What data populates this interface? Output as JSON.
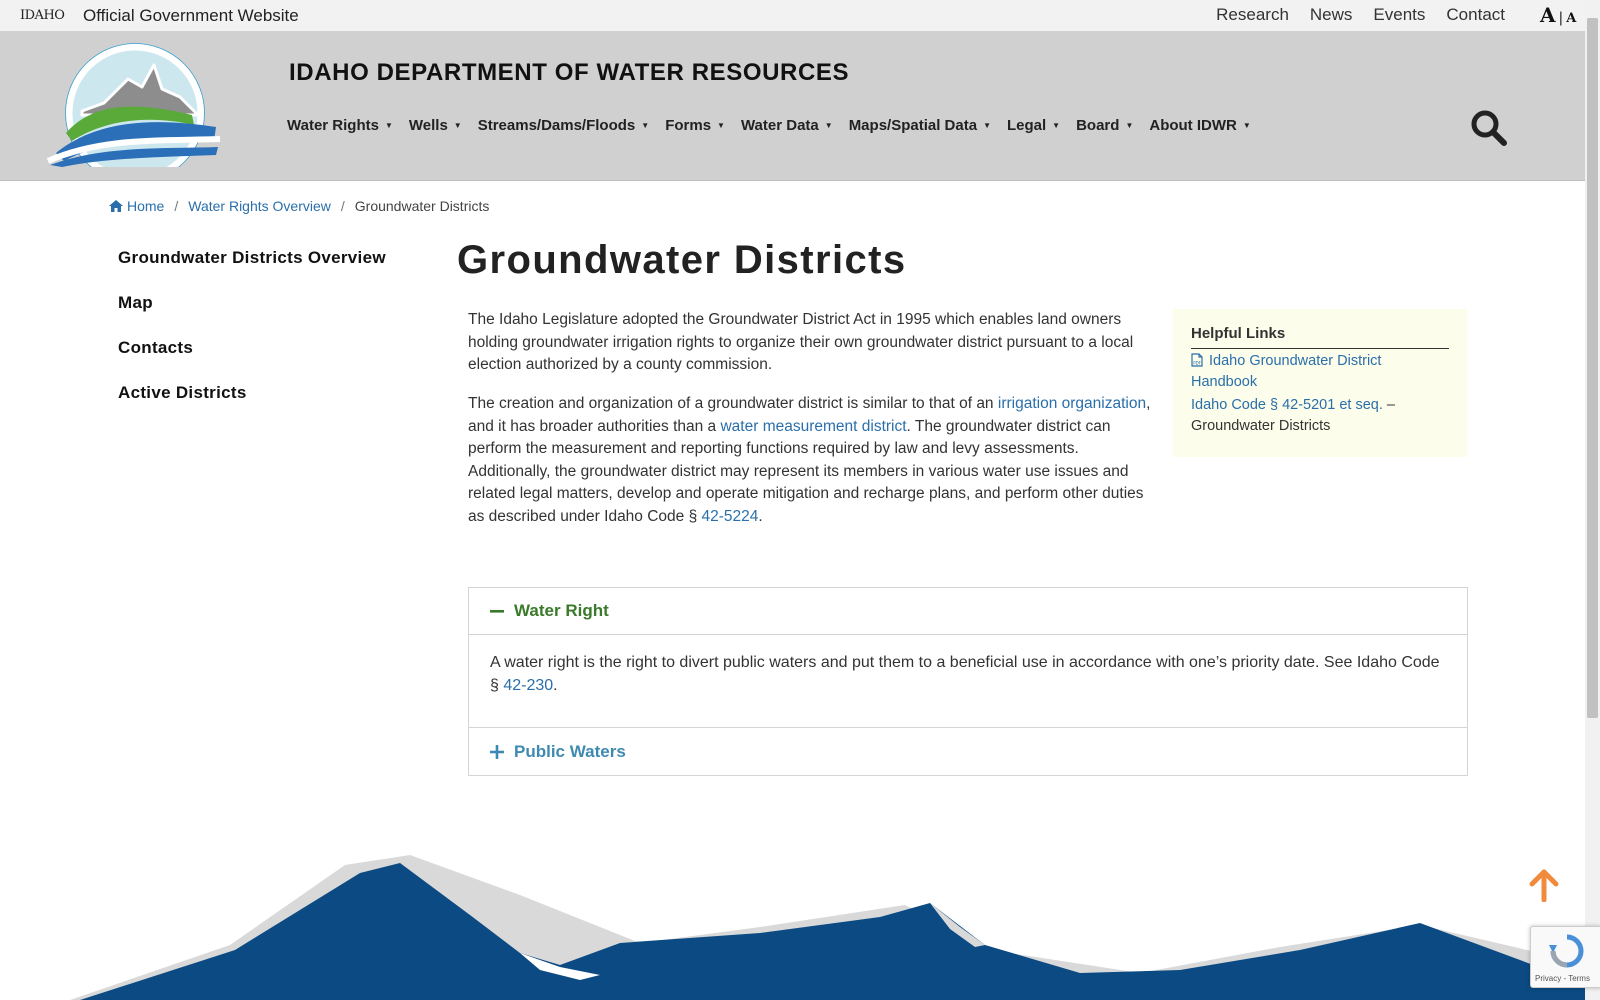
{
  "topbar": {
    "state_logo": "IDAHO",
    "official_label": "Official Government Website",
    "links": [
      "Research",
      "News",
      "Events",
      "Contact"
    ],
    "font_size_large": "A",
    "font_size_separator": "|",
    "font_size_small": "A"
  },
  "header": {
    "site_title": "IDAHO DEPARTMENT OF WATER RESOURCES",
    "nav": [
      "Water Rights",
      "Wells",
      "Streams/Dams/Floods",
      "Forms",
      "Water Data",
      "Maps/Spatial Data",
      "Legal",
      "Board",
      "About IDWR"
    ],
    "caret": "▼"
  },
  "breadcrumb": {
    "home": "Home",
    "separator": "/",
    "parent": "Water Rights Overview",
    "current": "Groundwater Districts"
  },
  "sidenav": [
    "Groundwater Districts Overview",
    "Map",
    "Contacts",
    "Active Districts"
  ],
  "main": {
    "title": "Groundwater Districts",
    "p1": "The Idaho Legislature adopted the Groundwater District Act in 1995 which enables land owners holding groundwater irrigation rights to organize their own groundwater district pursuant to a local election authorized by a county commission.",
    "p2_a": "The creation and organization of a groundwater district is similar to that of an ",
    "p2_link1": "irrigation organization",
    "p2_b": ", and it has broader authorities than a ",
    "p2_link2": "water measurement district",
    "p2_c": ". The groundwater district can perform the measurement and reporting functions required by law and levy assessments. Additionally, the groundwater district may represent its members in various water use issues and related legal matters, develop and operate mitigation and recharge plans, and perform other duties as described under Idaho Code § ",
    "p2_link3": "42-5224",
    "p2_d": "."
  },
  "helpful_links": {
    "heading": "Helpful Links",
    "link1": "Idaho Groundwater District Handbook",
    "link2": "Idaho Code § 42-5201 et seq.",
    "link2_suffix": " – Groundwater Districts"
  },
  "accordion": {
    "open_title": "Water Right",
    "open_body_a": "A water right is the right to divert public waters and put them to a beneficial use in accordance with one’s priority date. See Idaho Code § ",
    "open_body_link": "42-230",
    "open_body_b": ".",
    "closed_title": "Public Waters"
  },
  "recaptcha": {
    "text": "Privacy - Terms"
  },
  "colors": {
    "link": "#2a6faa",
    "accordion_open": "#3a7a2a",
    "accordion_closed": "#3e8ab0",
    "back_to_top": "#f08a3c",
    "mountain_blue": "#0b4a82"
  },
  "icons": [
    "home-icon",
    "pdf-icon",
    "search-icon",
    "minus-icon",
    "plus-icon",
    "arrow-up-icon"
  ]
}
